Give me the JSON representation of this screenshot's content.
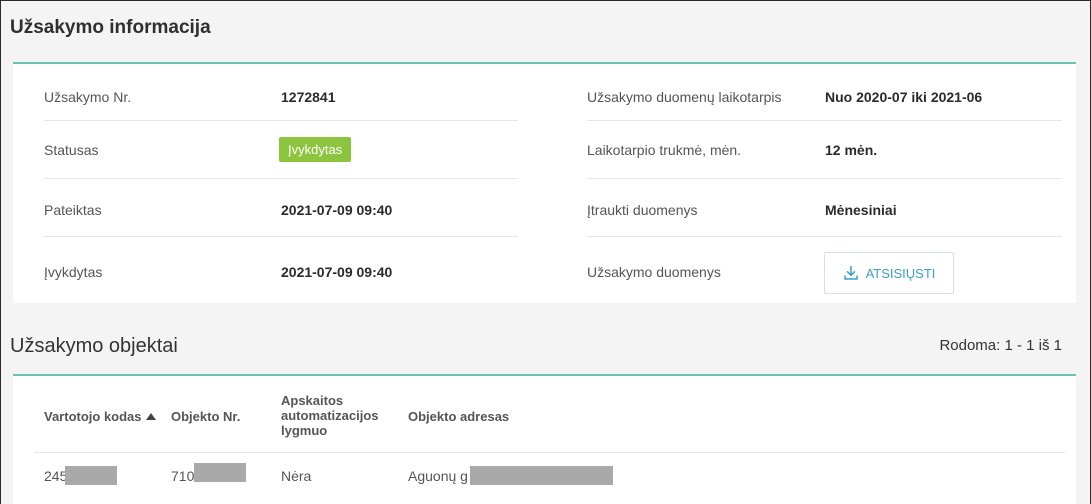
{
  "order_info": {
    "title": "Užsakymo informacija",
    "left": [
      {
        "label": "Užsakymo Nr.",
        "value": "1272841"
      },
      {
        "label": "Statusas",
        "value": "Įvykdytas"
      },
      {
        "label": "Pateiktas",
        "value": "2021-07-09 09:40"
      },
      {
        "label": "Įvykdytas",
        "value": "2021-07-09 09:40"
      }
    ],
    "right": [
      {
        "label": "Užsakymo duomenų laikotarpis",
        "value": "Nuo 2020-07 iki 2021-06"
      },
      {
        "label": "Laikotarpio trukmė, mėn.",
        "value": "12 mėn."
      },
      {
        "label": "Įtraukti duomenys",
        "value": "Mėnesiniai"
      },
      {
        "label": "Užsakymo duomenys",
        "value": "ATSISIŲSTI"
      }
    ],
    "status_color": "#8cc43d",
    "download_icon": "download-icon"
  },
  "objects": {
    "title": "Užsakymo objektai",
    "shown": "Rodoma: 1 - 1 iš 1",
    "columns": [
      "Vartotojo kodas",
      "Objekto Nr.",
      "Apskaitos automatizacijos lygmuo",
      "Objekto adresas"
    ],
    "rows": [
      {
        "code": "245",
        "object_no": "710",
        "level": "Nėra",
        "address": "Aguonų g"
      }
    ]
  },
  "accent_color": "#6cc4b6"
}
